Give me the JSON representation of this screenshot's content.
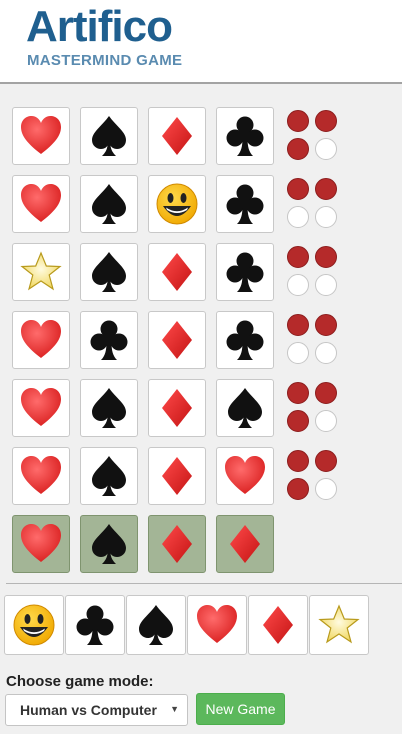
{
  "header": {
    "logo_title": "Artifico",
    "logo_subtitle": "MASTERMIND GAME"
  },
  "board": {
    "guesses": [
      {
        "cards": [
          "heart-icon",
          "spade-icon",
          "diamond-icon",
          "club-icon"
        ],
        "pegs": [
          "red",
          "red",
          "red",
          "white"
        ]
      },
      {
        "cards": [
          "heart-icon",
          "spade-icon",
          "smiley-icon",
          "club-icon"
        ],
        "pegs": [
          "red",
          "red",
          "white",
          "white"
        ]
      },
      {
        "cards": [
          "star-icon",
          "spade-icon",
          "diamond-icon",
          "club-icon"
        ],
        "pegs": [
          "red",
          "red",
          "white",
          "white"
        ]
      },
      {
        "cards": [
          "heart-icon",
          "club-icon",
          "diamond-icon",
          "club-icon"
        ],
        "pegs": [
          "red",
          "red",
          "white",
          "white"
        ]
      },
      {
        "cards": [
          "heart-icon",
          "spade-icon",
          "diamond-icon",
          "spade-icon"
        ],
        "pegs": [
          "red",
          "red",
          "red",
          "white"
        ]
      },
      {
        "cards": [
          "heart-icon",
          "spade-icon",
          "diamond-icon",
          "heart-icon"
        ],
        "pegs": [
          "red",
          "red",
          "red",
          "white"
        ]
      }
    ],
    "answer": [
      "heart-icon",
      "spade-icon",
      "diamond-icon",
      "diamond-icon"
    ]
  },
  "palette": [
    "smiley-icon",
    "club-icon",
    "spade-icon",
    "heart-icon",
    "diamond-icon",
    "star-icon"
  ],
  "controls": {
    "mode_label": "Choose game mode:",
    "mode_selected": "Human vs Computer",
    "new_game_label": "New Game"
  },
  "colors": {
    "peg_red": "#b52a2a",
    "peg_white": "#ffffff",
    "answer_bg": "#a3b596",
    "brand_blue": "#1f5f8f",
    "button_green": "#5cb85c"
  }
}
